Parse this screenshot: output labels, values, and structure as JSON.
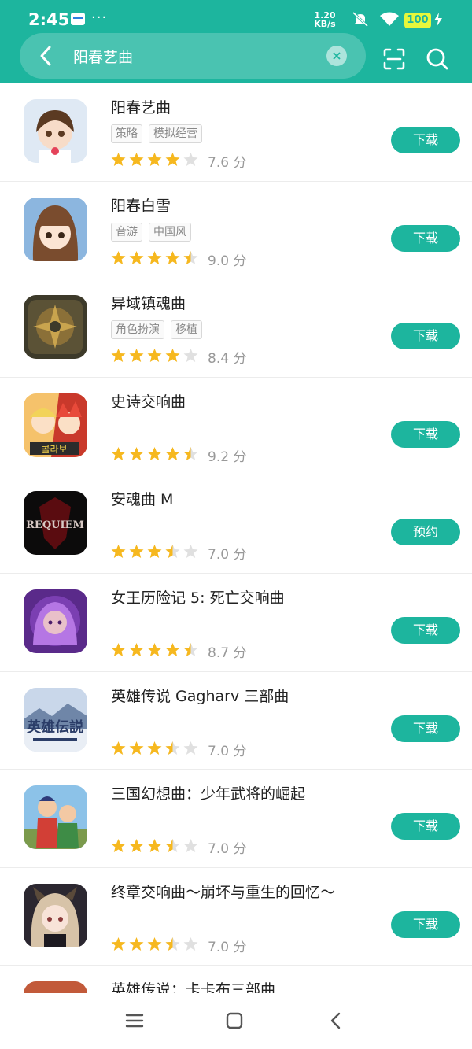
{
  "status": {
    "time": "2:45",
    "more": "···",
    "net_speed_value": "1.20",
    "net_speed_unit": "KB/s",
    "battery": "100"
  },
  "search": {
    "query": "阳春艺曲"
  },
  "colors": {
    "brand": "#1db59e",
    "star_on": "#f6b81f",
    "star_off": "#e0e0e0"
  },
  "results": [
    {
      "name": "阳春艺曲",
      "tags": [
        "策略",
        "模拟经营"
      ],
      "stars": 4,
      "score": "7.6 分",
      "action": "下载",
      "icon": "anime-girl-icon"
    },
    {
      "name": "阳春白雪",
      "tags": [
        "音游",
        "中国风"
      ],
      "stars": 4.5,
      "score": "9.0 分",
      "action": "下载",
      "icon": "anime-girl-bangs-icon"
    },
    {
      "name": "异域镇魂曲",
      "tags": [
        "角色扮演",
        "移植"
      ],
      "stars": 4,
      "score": "8.4 分",
      "action": "下载",
      "icon": "bronze-emblem-icon"
    },
    {
      "name": "史诗交响曲",
      "tags": [],
      "stars": 4.5,
      "score": "9.2 分",
      "action": "下载",
      "icon": "collab-heroes-icon"
    },
    {
      "name": "安魂曲 M",
      "tags": [],
      "stars": 3.5,
      "score": "7.0 分",
      "action": "预约",
      "icon": "requiem-logo-icon"
    },
    {
      "name": "女王历险记 5: 死亡交响曲",
      "tags": [],
      "stars": 4.5,
      "score": "8.7 分",
      "action": "下载",
      "icon": "purple-queen-icon"
    },
    {
      "name": "英雄传说 Gagharv 三部曲",
      "tags": [],
      "stars": 3.5,
      "score": "7.0 分",
      "action": "下载",
      "icon": "legend-title-icon"
    },
    {
      "name": "三国幻想曲：少年武将的崛起",
      "tags": [],
      "stars": 3.5,
      "score": "7.0 分",
      "action": "下载",
      "icon": "warriors-icon"
    },
    {
      "name": "终章交响曲～崩坏与重生的回忆～",
      "tags": [],
      "stars": 3.5,
      "score": "7.0 分",
      "action": "下载",
      "icon": "horned-girl-icon"
    }
  ],
  "partial_result": {
    "name": "英雄传说：卡卡布三部曲"
  }
}
